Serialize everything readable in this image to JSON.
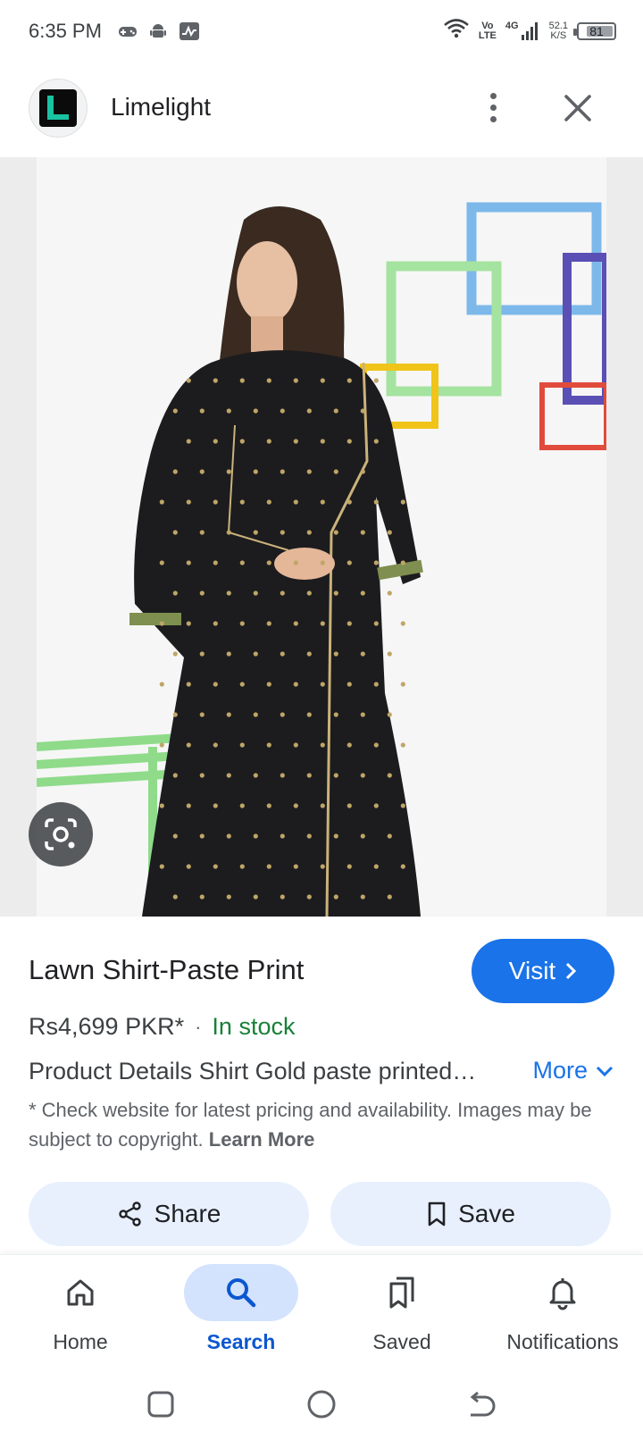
{
  "status_bar": {
    "time": "6:35 PM",
    "network_type_top": "Vo",
    "network_type_bottom": "LTE",
    "cell_gen": "4G",
    "speed_value": "52.1",
    "speed_unit": "K/S",
    "battery_level": "81",
    "battery_fraction": 0.81
  },
  "header": {
    "site_name": "Limelight",
    "logo_letter": "L"
  },
  "image": {
    "lens_icon": "google-lens-icon"
  },
  "product": {
    "title": "Lawn Shirt-Paste Print",
    "visit_label": "Visit",
    "price": "Rs4,699 PKR*",
    "separator": "·",
    "stock_status": "In stock",
    "description": "Product Details Shirt Gold paste printed…",
    "more_label": "More",
    "disclaimer": "* Check website for latest pricing and availability. Images may be subject to copyright.",
    "learn_more": "Learn More"
  },
  "actions": {
    "share_label": "Share",
    "save_label": "Save"
  },
  "bottom_nav": {
    "items": [
      {
        "label": "Home",
        "icon": "home-icon"
      },
      {
        "label": "Search",
        "icon": "search-icon",
        "active": true
      },
      {
        "label": "Saved",
        "icon": "bookmarks-icon"
      },
      {
        "label": "Notifications",
        "icon": "bell-icon"
      }
    ]
  },
  "colors": {
    "accent": "#1a73e8",
    "in_stock": "#188038",
    "active_nav": "#0b57d0",
    "action_bg": "#e8f0fe"
  }
}
